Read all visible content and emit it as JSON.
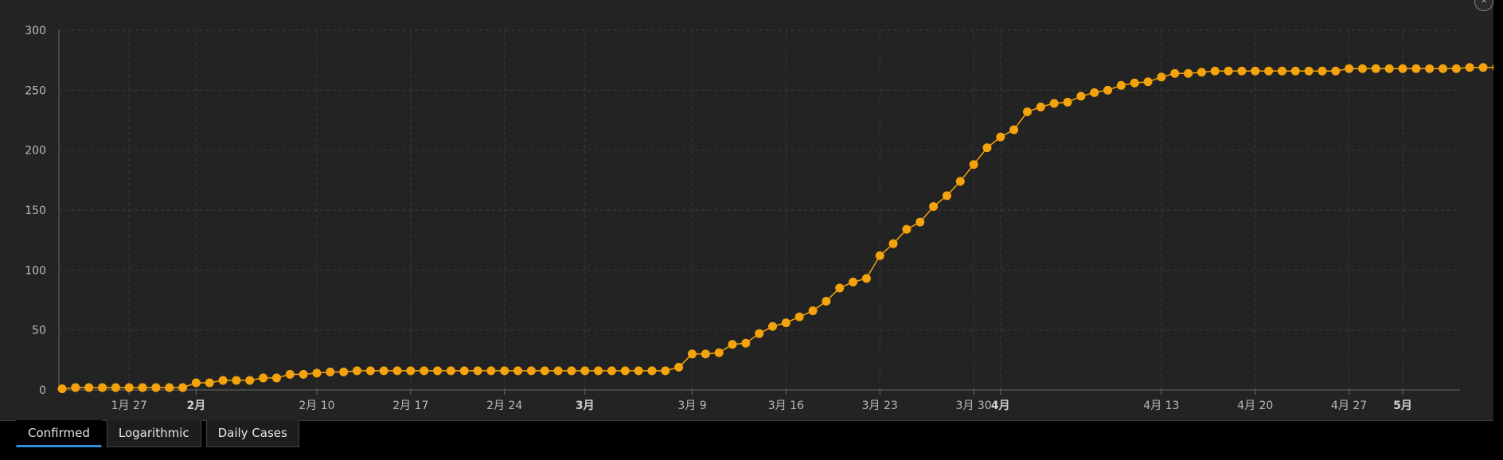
{
  "colors": {
    "panel_bg": "#232323",
    "grid": "#3c3c3c",
    "axis": "#6a6a6a",
    "series": "#f5a30c",
    "tab_accent": "#2e8fe0"
  },
  "tabs": [
    {
      "label": "Confirmed",
      "active": true
    },
    {
      "label": "Logarithmic",
      "active": false
    },
    {
      "label": "Daily Cases",
      "active": false
    }
  ],
  "close_icon": "close-icon",
  "chart_data": {
    "type": "line",
    "markers": true,
    "title": "",
    "xlabel": "",
    "ylabel": "",
    "x_start": "2020-01-22",
    "ylim": [
      0,
      300
    ],
    "yticks": [
      0,
      50,
      100,
      150,
      200,
      250,
      300
    ],
    "xticks": [
      {
        "label": "1月 27",
        "date": "2020-01-27",
        "bold": false
      },
      {
        "label": "2月",
        "date": "2020-02-01",
        "bold": true
      },
      {
        "label": "2月 10",
        "date": "2020-02-10",
        "bold": false
      },
      {
        "label": "2月 17",
        "date": "2020-02-17",
        "bold": false
      },
      {
        "label": "2月 24",
        "date": "2020-02-24",
        "bold": false
      },
      {
        "label": "3月",
        "date": "2020-03-01",
        "bold": true
      },
      {
        "label": "3月 9",
        "date": "2020-03-09",
        "bold": false
      },
      {
        "label": "3月 16",
        "date": "2020-03-16",
        "bold": false
      },
      {
        "label": "3月 23",
        "date": "2020-03-23",
        "bold": false
      },
      {
        "label": "3月 30",
        "date": "2020-03-30",
        "bold": false
      },
      {
        "label": "4月",
        "date": "2020-04-01",
        "bold": true
      },
      {
        "label": "4月 13",
        "date": "2020-04-13",
        "bold": false
      },
      {
        "label": "4月 20",
        "date": "2020-04-20",
        "bold": false
      },
      {
        "label": "4月 27",
        "date": "2020-04-27",
        "bold": false
      },
      {
        "label": "5月",
        "date": "2020-05-01",
        "bold": true
      }
    ],
    "grid": true,
    "series": [
      {
        "name": "Confirmed",
        "values": [
          1,
          2,
          2,
          2,
          2,
          2,
          2,
          2,
          2,
          2,
          6,
          6,
          8,
          8,
          8,
          10,
          10,
          13,
          13,
          14,
          15,
          15,
          16,
          16,
          16,
          16,
          16,
          16,
          16,
          16,
          16,
          16,
          16,
          16,
          16,
          16,
          16,
          16,
          16,
          16,
          16,
          16,
          16,
          16,
          16,
          16,
          19,
          30,
          30,
          31,
          38,
          39,
          47,
          53,
          56,
          61,
          66,
          74,
          85,
          90,
          93,
          112,
          122,
          134,
          140,
          153,
          162,
          174,
          188,
          202,
          211,
          217,
          232,
          236,
          239,
          240,
          245,
          248,
          250,
          254,
          256,
          257,
          261,
          264,
          264,
          265,
          266,
          266,
          266,
          266,
          266,
          266,
          266,
          266,
          266,
          266,
          268,
          268,
          268,
          268,
          268,
          268,
          268,
          268,
          268,
          269,
          269,
          269
        ]
      }
    ]
  }
}
